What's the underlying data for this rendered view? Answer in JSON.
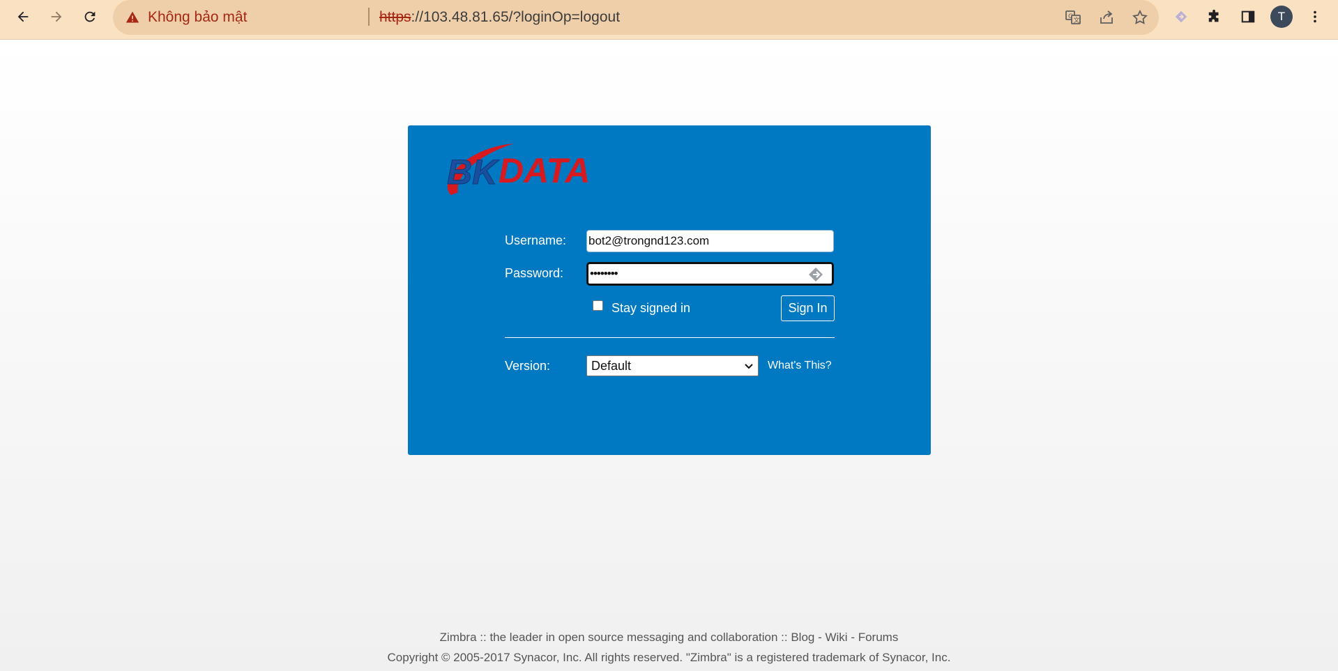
{
  "browser": {
    "security_text": "Không bảo mật",
    "url_scheme": "https",
    "url_rest": "://103.48.81.65/?loginOp=logout",
    "profile_initial": "T",
    "icons": [
      "back-icon",
      "forward-icon",
      "reload-icon",
      "warning-icon",
      "translate-icon",
      "share-icon",
      "bookmark-star-icon",
      "extension-arrow-icon",
      "puzzle-icon",
      "side-panel-icon",
      "menu-icon"
    ],
    "accent_color": "#fae1c1"
  },
  "login": {
    "logo_text_1": "BK",
    "logo_text_2": "DATA",
    "username_label": "Username:",
    "username_value": "bot2@trongnd123.com",
    "password_label": "Password:",
    "password_value": "••••••••",
    "stay_signed_in_label": "Stay signed in",
    "stay_signed_in_checked": false,
    "sign_in_label": "Sign In",
    "version_label": "Version:",
    "version_selected": "Default",
    "whats_this_label": "What's This?",
    "panel_color": "#0079c2"
  },
  "footer": {
    "line1_prefix": "Zimbra :: the leader in open source messaging and collaboration :: ",
    "blog": "Blog",
    "dash1": " - ",
    "wiki": "Wiki",
    "dash2": " - ",
    "forums": "Forums",
    "line2": "Copyright © 2005-2017 Synacor, Inc. All rights reserved. \"Zimbra\" is a registered trademark of Synacor, Inc."
  }
}
